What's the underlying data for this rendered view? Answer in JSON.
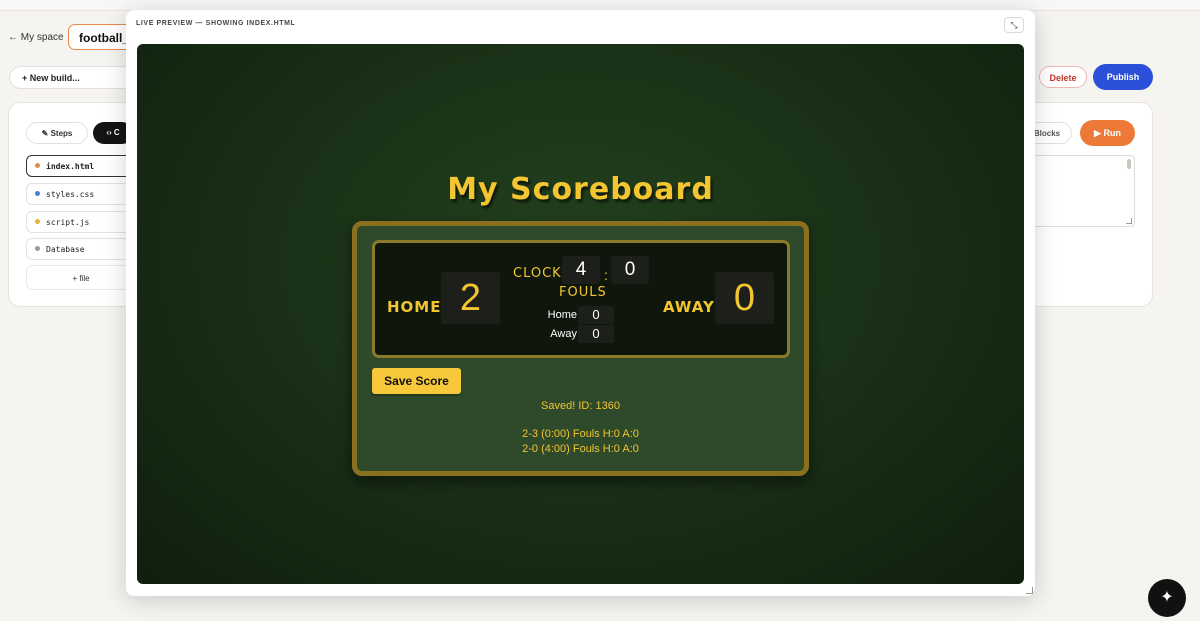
{
  "editor": {
    "back_label": "← My space",
    "project_name": "football_",
    "new_build_label": "+ New build...",
    "delete_label": "Delete",
    "publish_label": "Publish",
    "steps_label": "Steps",
    "code_label": "‹› C",
    "blocks_label": "Blocks",
    "run_label": "▶ Run",
    "files": [
      {
        "name": "index.html",
        "color": "#e8894a"
      },
      {
        "name": "styles.css",
        "color": "#4a7fd6"
      },
      {
        "name": "script.js",
        "color": "#e8b23a"
      },
      {
        "name": "Database",
        "color": "#9a9a9a"
      }
    ],
    "add_file_label": "+ file"
  },
  "modal": {
    "title": "LIVE PREVIEW — SHOWING INDEX.HTML"
  },
  "scoreboard": {
    "title": "My Scoreboard",
    "home_label": "HOME",
    "home_score": "2",
    "away_label": "AWAY",
    "away_score": "0",
    "clock_label": "CLOCK",
    "clock_minutes": "4",
    "clock_separator": ":",
    "clock_seconds": "0",
    "fouls_label": "FOULS",
    "fouls_home_label": "Home",
    "fouls_home_value": "0",
    "fouls_away_label": "Away",
    "fouls_away_value": "0",
    "save_button_label": "Save Score",
    "saved_message": "Saved! ID: 1360",
    "history": [
      "2-3 (0:00) Fouls H:0 A:0",
      "2-0 (4:00) Fouls H:0 A:0"
    ]
  },
  "colors": {
    "accent_gold": "#f2c531",
    "publish_blue": "#2b4fd8",
    "run_orange": "#ec7a36"
  }
}
